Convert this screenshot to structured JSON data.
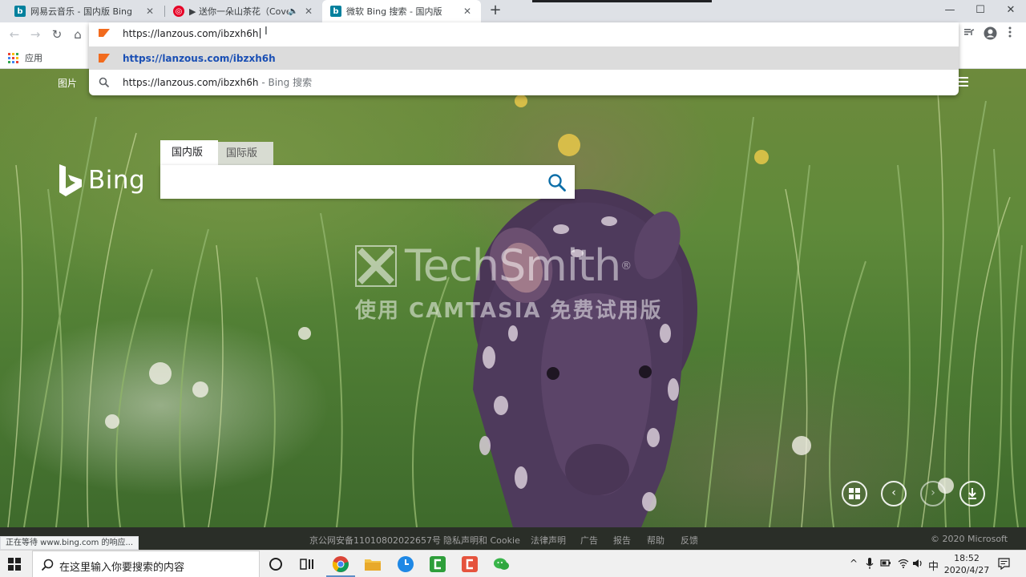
{
  "tabs": [
    {
      "title": "网易云音乐 - 国内版 Bing",
      "favicon": "bing-icon"
    },
    {
      "title": "▶ 送你一朵山茶花（Cover：",
      "favicon": "netease-music-icon",
      "audio_icon": "🔈"
    },
    {
      "title": "微软 Bing 搜索 - 国内版",
      "favicon": "bing-icon",
      "active": true
    }
  ],
  "tab_close": "✕",
  "new_tab": "+",
  "window_controls": {
    "minimize": "—",
    "maximize": "☐",
    "close": "✕"
  },
  "toolbar": {
    "back": "←",
    "forward": "→",
    "reload": "↻",
    "home": "⌂"
  },
  "bookmarks": {
    "apps_label": "应用"
  },
  "omnibox": {
    "input_value": "https://lanzous.com/ibzxh6h",
    "ibeam": "I",
    "suggestions": [
      {
        "text": "https://lanzous.com/ibzxh6h",
        "suffix": "",
        "icon": "site-flag-icon",
        "selected": true
      },
      {
        "text": "https://lanzous.com/ibzxh6h",
        "suffix": " - Bing 搜索",
        "icon": "search-icon",
        "selected": false
      }
    ]
  },
  "bing": {
    "images_link": "图片",
    "logo_text": "Bing",
    "tab_domestic": "国内版",
    "tab_international": "国际版",
    "search_placeholder": ""
  },
  "watermark": {
    "line1": "TechSmith",
    "registered": "®",
    "line2": "使用 CAMTASIA 免费试用版"
  },
  "footer": {
    "status_text": "正在等待 www.bing.com 的响应...",
    "items": [
      "京公网安备11010802022657号",
      "隐私声明和 Cookie",
      "法律声明",
      "广告",
      "报告",
      "帮助",
      "反馈"
    ],
    "copyright": "© 2020 Microsoft"
  },
  "taskbar": {
    "search_placeholder": "在这里输入你要搜索的内容",
    "ime": "中",
    "time": "18:52",
    "date": "2020/4/27"
  },
  "colors": {
    "bing_teal": "#00809d",
    "chrome_tabstrip": "#dee1e6",
    "link_blue": "#1a4fb4",
    "selected_row": "#dcdcdc",
    "footer_bg": "#282828",
    "taskbar_bg": "#f0f0f0"
  }
}
